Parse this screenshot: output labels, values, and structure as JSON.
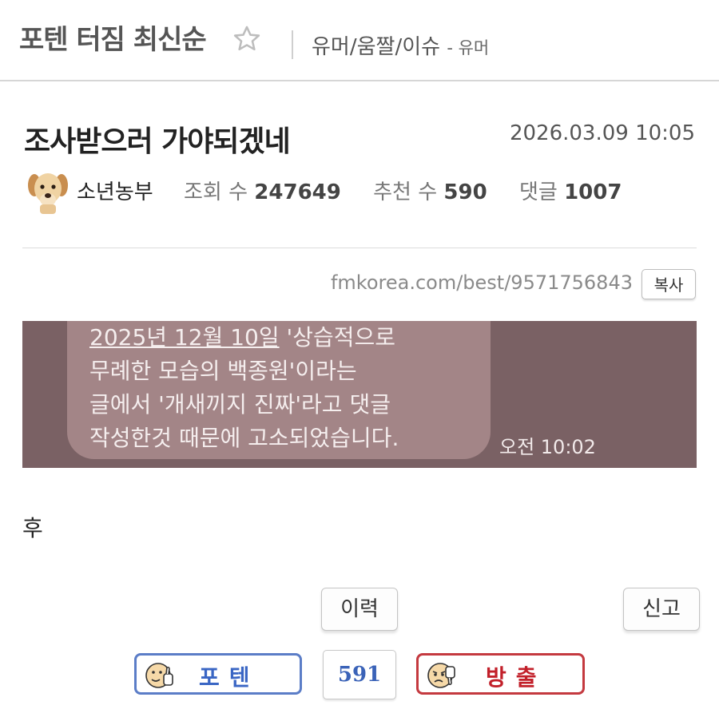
{
  "header": {
    "board_title": "포텐 터짐 최신순",
    "category": "유머/움짤/이슈",
    "sub_category": "- 유머"
  },
  "post": {
    "title": "조사받으러 가야되겠네",
    "date": "2026.03.09 10:05",
    "author": "소년농부",
    "views_label": "조회 수",
    "views": "247649",
    "recommend_label": "추천 수",
    "recommend": "590",
    "comments_label": "댓글",
    "comments": "1007",
    "url": "fmkorea.com/best/9571756843",
    "copy_label": "복사",
    "image_message": {
      "date": "2025년 12월 10일",
      "line1_rest": " '상습적으로",
      "line2": "무례한 모습의 백종원'이라는",
      "line3": "글에서 '개새끼지 진짜'라고 댓글",
      "line4": "작성한것 때문에 고소되었습니다.",
      "time": "오전 10:02"
    },
    "body": "후"
  },
  "actions": {
    "history_label": "이력",
    "report_label": "신고",
    "upvote_label": "포텐",
    "vote_count": "591",
    "downvote_label": "방출"
  },
  "colors": {
    "upvote": "#3a66c4",
    "downvote": "#c2202a",
    "image_bg": "#7a6164",
    "bubble": "#a38587"
  },
  "icons": {
    "favorite": "star-outline-icon",
    "avatar": "puppy-avatar-icon",
    "upvote": "thumbs-up-face-icon",
    "downvote": "thumbs-down-face-icon"
  }
}
